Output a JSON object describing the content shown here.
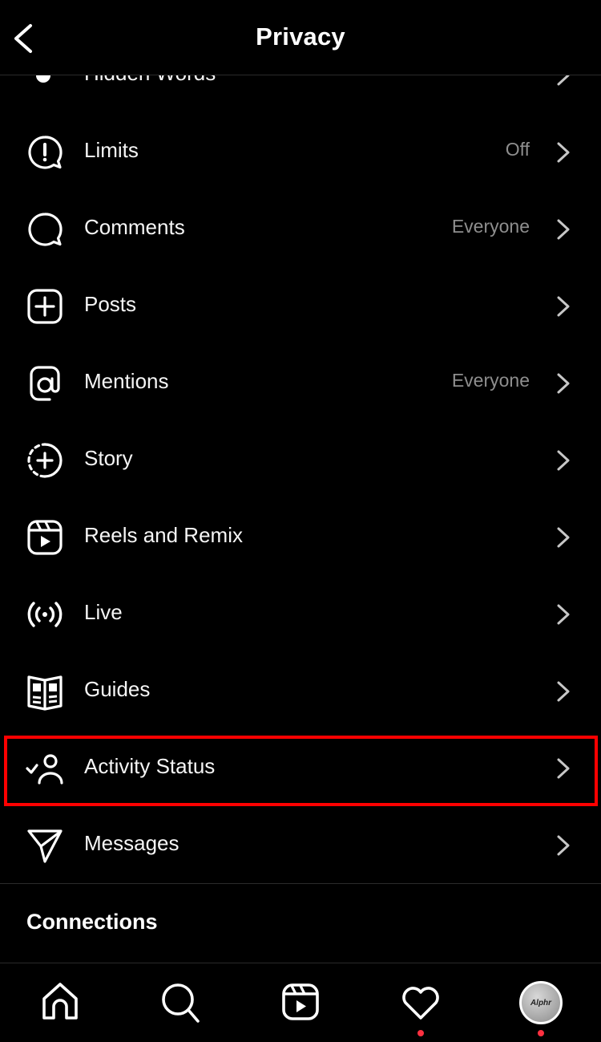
{
  "header": {
    "title": "Privacy",
    "back_icon": "chevron-left-icon"
  },
  "items": [
    {
      "label": "Hidden Words",
      "value": "",
      "icon": "hidden-words-icon"
    },
    {
      "label": "Limits",
      "value": "Off",
      "icon": "limits-icon"
    },
    {
      "label": "Comments",
      "value": "Everyone",
      "icon": "comment-icon"
    },
    {
      "label": "Posts",
      "value": "",
      "icon": "plus-square-icon"
    },
    {
      "label": "Mentions",
      "value": "Everyone",
      "icon": "at-sign-icon"
    },
    {
      "label": "Story",
      "value": "",
      "icon": "story-add-icon"
    },
    {
      "label": "Reels and Remix",
      "value": "",
      "icon": "reels-icon"
    },
    {
      "label": "Live",
      "value": "",
      "icon": "live-broadcast-icon"
    },
    {
      "label": "Guides",
      "value": "",
      "icon": "guides-book-icon"
    },
    {
      "label": "Activity Status",
      "value": "",
      "icon": "activity-status-icon",
      "highlighted": true
    },
    {
      "label": "Messages",
      "value": "",
      "icon": "paper-plane-icon"
    }
  ],
  "section": {
    "title": "Connections"
  },
  "tabbar": {
    "tabs": [
      "home",
      "search",
      "reels",
      "activity",
      "profile"
    ],
    "avatar_text": "Alphr",
    "notification_color": "#ff3040"
  },
  "colors": {
    "highlight": "#ff0000",
    "secondary_text": "#8e8e8e"
  }
}
